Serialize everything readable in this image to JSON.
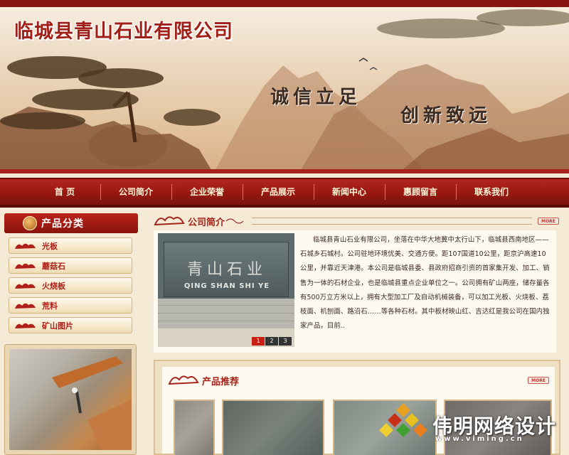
{
  "header": {
    "site_title": "临城县青山石业有限公司",
    "slogan_1": "诚信立足",
    "slogan_2": "创新致远"
  },
  "nav": {
    "items": [
      {
        "label": "首 页"
      },
      {
        "label": "公司简介"
      },
      {
        "label": "企业荣誉"
      },
      {
        "label": "产品展示"
      },
      {
        "label": "新闻中心"
      },
      {
        "label": "惠顾留言"
      },
      {
        "label": "联系我们"
      }
    ]
  },
  "sidebar": {
    "category_title": "产品分类",
    "categories": [
      {
        "label": "光板"
      },
      {
        "label": "蘑菇石"
      },
      {
        "label": "火烧板"
      },
      {
        "label": "荒料"
      },
      {
        "label": "矿山图片"
      }
    ]
  },
  "about": {
    "title": "公司简介",
    "more_label": "MORE",
    "photo_cn": "青山石业",
    "photo_en": "QING SHAN SHI YE",
    "pager": [
      "1",
      "2",
      "3"
    ],
    "pager_active": "1",
    "text": "临城县青山石业有限公司，坐落在中华大地冀中太行山下，临城县西南地区——石城乡石城村。公司驻地环境优美、交通方便。距107国道10公里，距京沪高速10公里，并靠近天津港。本公司是临城县委、县政府招商引资的首家集开发、加工、销售为一体的石材企业，也是临城县重点企业单位之一。公司拥有矿山两座，储存量各有500万立方米以上，拥有大型加工厂及自动机械装备，可以加工光板、火烧板、荔枝面、机刨面、路沿石……等各种石材。其中板材映山红、吉达红是我公司在国内独家产品，目前.."
  },
  "products": {
    "title": "产品推荐",
    "more_label": "MORE"
  },
  "watermark": {
    "text": "伟明网络设计",
    "url": "www.viming.cn"
  },
  "colors": {
    "brand_red": "#a01f17",
    "nav_red": "#951711",
    "cream": "#fffaf0"
  }
}
